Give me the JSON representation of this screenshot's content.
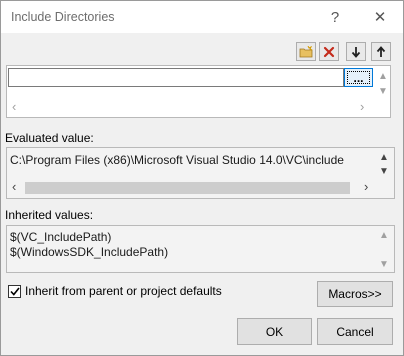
{
  "window": {
    "title": "Include Directories",
    "help_label": "?",
    "close_label": "✕"
  },
  "toolbar": {
    "new_line_icon": "new-folder-icon",
    "delete_icon": "delete-x-icon",
    "move_down_icon": "arrow-down-icon",
    "move_up_icon": "arrow-up-icon"
  },
  "editor": {
    "value": "",
    "browse_label": "..."
  },
  "evaluated": {
    "label": "Evaluated value:",
    "lines": [
      "C:\\Program Files (x86)\\Microsoft Visual Studio 14.0\\VC\\include"
    ]
  },
  "inherited": {
    "label": "Inherited values:",
    "lines": [
      "$(VC_IncludePath)",
      "$(WindowsSDK_IncludePath)"
    ]
  },
  "inherit_checkbox": {
    "label": "Inherit from parent or project defaults",
    "checked": true
  },
  "buttons": {
    "macros": "Macros>>",
    "ok": "OK",
    "cancel": "Cancel"
  },
  "colors": {
    "accent": "#0078d7",
    "delete_red": "#c42b1c"
  }
}
